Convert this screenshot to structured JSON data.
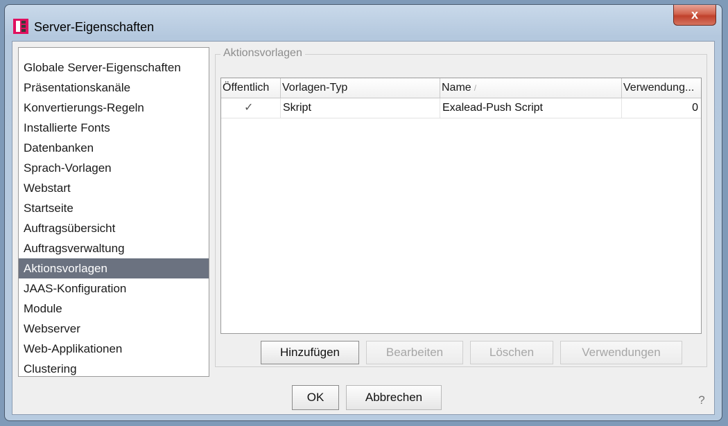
{
  "window": {
    "title": "Server-Eigenschaften",
    "close_label": "x"
  },
  "nav": {
    "items": [
      "Globale Server-Eigenschaften",
      "Präsentationskanäle",
      "Konvertierungs-Regeln",
      "Installierte Fonts",
      "Datenbanken",
      "Sprach-Vorlagen",
      "Webstart",
      "Startseite",
      "Auftragsübersicht",
      "Auftragsverwaltung",
      "Aktionsvorlagen",
      "JAAS-Konfiguration",
      "Module",
      "Webserver",
      "Web-Applikationen",
      "Clustering"
    ],
    "selected": "Aktionsvorlagen"
  },
  "panel": {
    "group_label": "Aktionsvorlagen",
    "columns": [
      "Öffentlich",
      "Vorlagen-Typ",
      "Name",
      "Verwendung..."
    ],
    "sort_indicator": "/",
    "rows": [
      {
        "public": "✓",
        "type": "Skript",
        "name": "Exalead-Push Script",
        "usage": "0"
      }
    ],
    "buttons": {
      "add": "Hinzufügen",
      "edit": "Bearbeiten",
      "delete": "Löschen",
      "usages": "Verwendungen"
    }
  },
  "footer": {
    "ok": "OK",
    "cancel": "Abbrechen",
    "help": "?"
  },
  "colors": {
    "selected_bg": "#6b7280",
    "close_red": "#c0412c",
    "disabled_text": "#a6a6a6"
  },
  "icons": {
    "app": "app-logo-icon",
    "close": "close-icon",
    "check": "checkmark-icon",
    "help": "help-icon"
  }
}
